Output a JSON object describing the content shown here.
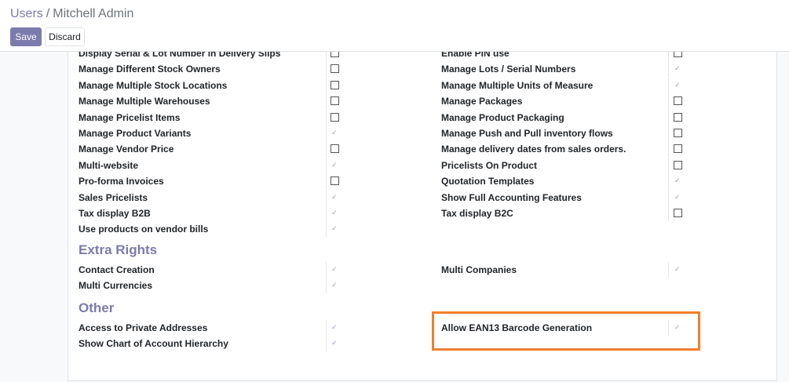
{
  "breadcrumb": {
    "parent": "Users",
    "separator": "/",
    "current": "Mitchell Admin"
  },
  "buttons": {
    "save": "Save",
    "discard": "Discard"
  },
  "top_rows_left": [
    {
      "label": "Display Serial & Lot Number in Delivery Slips",
      "checked": false
    },
    {
      "label": "Manage Different Stock Owners",
      "checked": false
    },
    {
      "label": "Manage Multiple Stock Locations",
      "checked": false
    },
    {
      "label": "Manage Multiple Warehouses",
      "checked": false
    },
    {
      "label": "Manage Pricelist Items",
      "checked": false
    },
    {
      "label": "Manage Product Variants",
      "checked": true
    },
    {
      "label": "Manage Vendor Price",
      "checked": false
    },
    {
      "label": "Multi-website",
      "checked": true
    },
    {
      "label": "Pro-forma Invoices",
      "checked": false
    },
    {
      "label": "Sales Pricelists",
      "checked": true
    },
    {
      "label": "Tax display B2B",
      "checked": true
    },
    {
      "label": "Use products on vendor bills",
      "checked": true
    }
  ],
  "top_rows_right": [
    {
      "label": "Enable PIN use",
      "checked": false
    },
    {
      "label": "Manage Lots / Serial Numbers",
      "checked": true
    },
    {
      "label": "Manage Multiple Units of Measure",
      "checked": true
    },
    {
      "label": "Manage Packages",
      "checked": false
    },
    {
      "label": "Manage Product Packaging",
      "checked": false
    },
    {
      "label": "Manage Push and Pull inventory flows",
      "checked": false
    },
    {
      "label": "Manage delivery dates from sales orders.",
      "checked": false
    },
    {
      "label": "Pricelists On Product",
      "checked": false
    },
    {
      "label": "Quotation Templates",
      "checked": true
    },
    {
      "label": "Show Full Accounting Features",
      "checked": true
    },
    {
      "label": "Tax display B2C",
      "checked": false
    }
  ],
  "extra_rights": {
    "title": "Extra Rights",
    "left": [
      {
        "label": "Contact Creation",
        "checked": true
      },
      {
        "label": "Multi Currencies",
        "checked": true
      }
    ],
    "right": [
      {
        "label": "Multi Companies",
        "checked": true
      }
    ]
  },
  "other": {
    "title": "Other",
    "left": [
      {
        "label": "Access to Private Addresses",
        "checked": true
      },
      {
        "label": "Show Chart of Account Hierarchy",
        "checked": true
      }
    ],
    "right": [
      {
        "label": "Allow EAN13 Barcode Generation",
        "checked": true
      }
    ]
  },
  "colors": {
    "brand": "#7c7bad",
    "highlight": "#f07f2e"
  }
}
